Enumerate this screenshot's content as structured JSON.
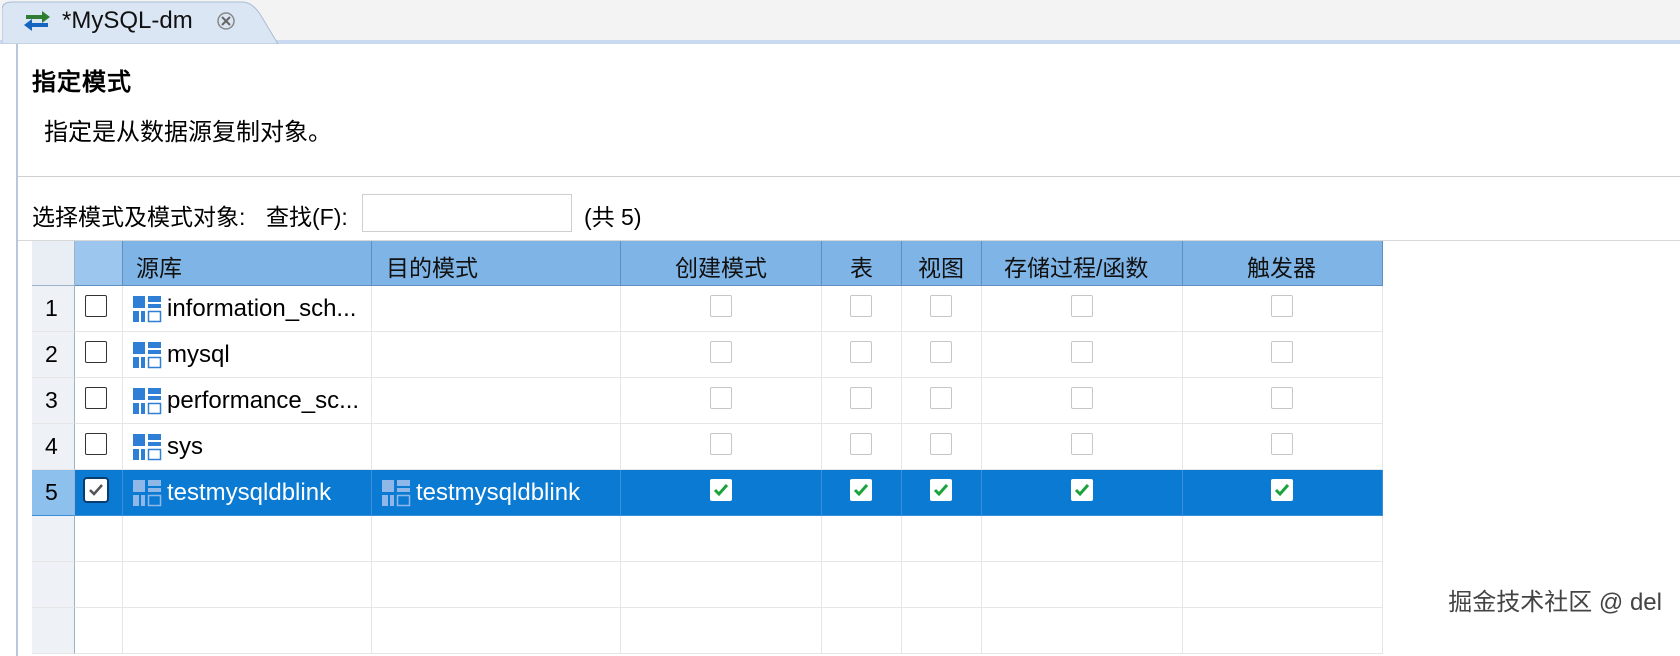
{
  "tab": {
    "title": "*MySQL-dm",
    "icon": "sync-arrows-icon",
    "close_icon": "close-icon"
  },
  "header": {
    "title": "指定模式",
    "description": "指定是从数据源复制对象。"
  },
  "filter": {
    "label": "选择模式及模式对象:",
    "find_label": "查找(F):",
    "value": "",
    "count": "(共 5)"
  },
  "grid": {
    "columns": [
      "源库",
      "目的模式",
      "创建模式",
      "表",
      "视图",
      "存储过程/函数",
      "触发器"
    ],
    "rows": [
      {
        "num": "1",
        "checked": false,
        "source": "information_sch...",
        "target": "",
        "create": false,
        "table": false,
        "view": false,
        "proc": false,
        "trigger": false
      },
      {
        "num": "2",
        "checked": false,
        "source": "mysql",
        "target": "",
        "create": false,
        "table": false,
        "view": false,
        "proc": false,
        "trigger": false
      },
      {
        "num": "3",
        "checked": false,
        "source": "performance_sc...",
        "target": "",
        "create": false,
        "table": false,
        "view": false,
        "proc": false,
        "trigger": false
      },
      {
        "num": "4",
        "checked": false,
        "source": "sys",
        "target": "",
        "create": false,
        "table": false,
        "view": false,
        "proc": false,
        "trigger": false
      },
      {
        "num": "5",
        "checked": true,
        "selected": true,
        "source": "testmysqldblink",
        "target": "testmysqldblink",
        "create": true,
        "table": true,
        "view": true,
        "proc": true,
        "trigger": true
      }
    ],
    "schema_icon": "schema-grid-icon",
    "selection_color": "#0a7ad3",
    "header_color": "#7fb4e6"
  },
  "watermark": "掘金技术社区 @ del"
}
